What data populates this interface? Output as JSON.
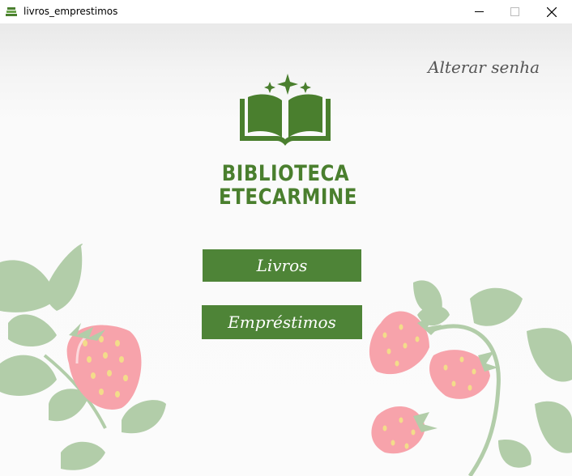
{
  "window": {
    "title": "livros_emprestimos"
  },
  "header": {
    "change_password_label": "Alterar senha"
  },
  "logo": {
    "line1": "BIBLIOTECA",
    "line2": "ETECARMINE"
  },
  "menu": {
    "livros_label": "Livros",
    "emprestimos_label": "Empréstimos"
  },
  "colors": {
    "accent": "#4e8437",
    "logo_green": "#4a7f2e",
    "leaf": "#b2cda9",
    "strawberry": "#f7a3ab",
    "seed": "#f3dc8a"
  },
  "icons": [
    "app-icon",
    "minimize-icon",
    "maximize-icon",
    "close-icon",
    "open-book-icon",
    "sparkle-icon"
  ]
}
